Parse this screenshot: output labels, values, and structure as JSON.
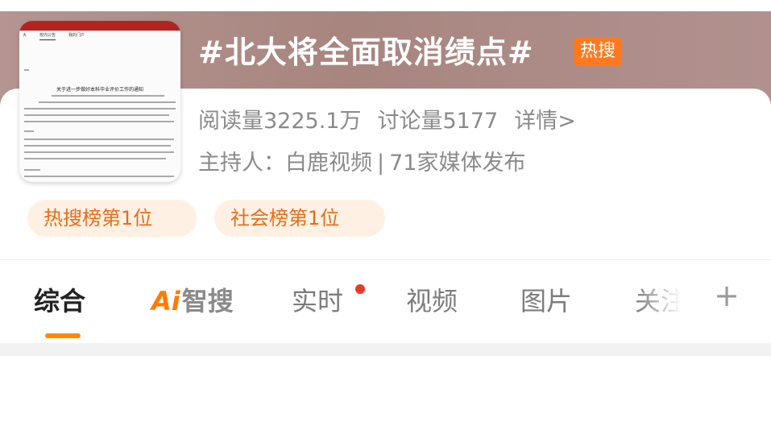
{
  "topic": {
    "title": "#北大将全面取消绩点#",
    "hot_badge": "热搜"
  },
  "thumbnail": {
    "doc_tabs": [
      "大",
      "校内公告",
      "我的门户"
    ],
    "doc_title": "关于进一步做好本科毕业评价工作的通知"
  },
  "stats": {
    "read_label": "阅读量3225.1万",
    "discuss_label": "讨论量5177",
    "detail_link": "详情>"
  },
  "host": {
    "prefix": "主持人：",
    "name": "白鹿视频",
    "separator": "|",
    "media_count": "71家媒体发布"
  },
  "ranks": [
    {
      "label": "热搜榜第1位"
    },
    {
      "label": "社会榜第1位"
    }
  ],
  "tabs": [
    {
      "label": "综合",
      "active": true
    },
    {
      "label_ai": "Ai",
      "label_rest": "智搜"
    },
    {
      "label": "实时",
      "has_dot": true
    },
    {
      "label": "视频"
    },
    {
      "label": "图片"
    },
    {
      "label": "关注"
    }
  ],
  "colors": {
    "accent": "#ff7a1f",
    "rank_text": "#e66d1a",
    "rank_bg": "#fef1e4",
    "header_bg": "#a8857f",
    "indicator": "#ff8a00"
  },
  "icons": {
    "add_tab": "plus-icon",
    "dot": "notification-dot-icon"
  }
}
